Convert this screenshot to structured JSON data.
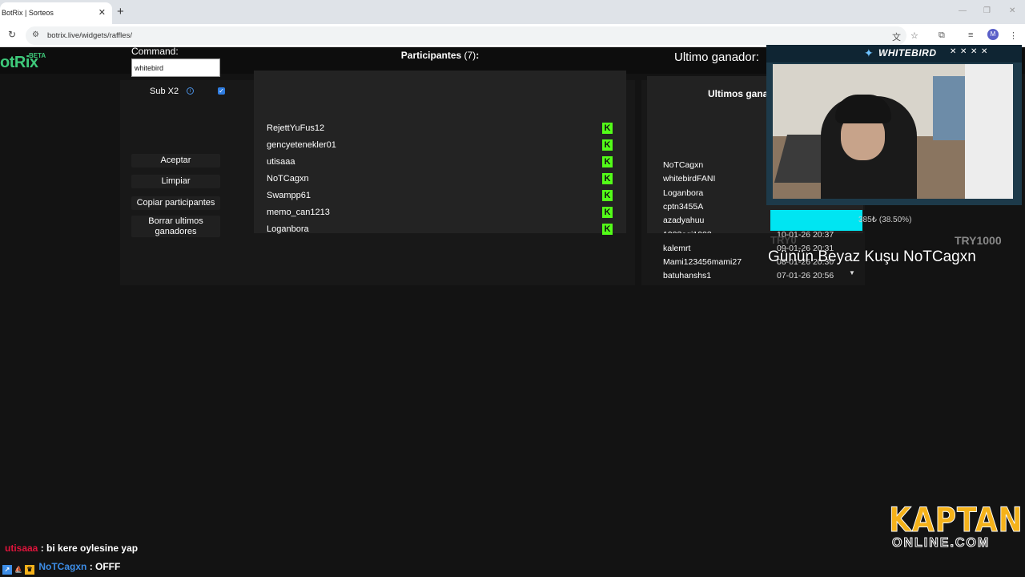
{
  "browser": {
    "tab_title": "BotRix | Sorteos",
    "tab_close": "✕",
    "new_tab": "+",
    "url": "botrix.live/widgets/raffles/",
    "profile_initial": "M"
  },
  "site": {
    "logo": "otRix",
    "beta": "BETA"
  },
  "controls": {
    "command_label": "Command:",
    "command_value": "whitebird",
    "sub_label": "Sub X2",
    "sub_checked": true,
    "accept": "Aceptar",
    "clear": "Limpiar",
    "copy": "Copiar participantes",
    "delete": "Borrar ultimos ganadores"
  },
  "participants": {
    "title": "Participantes",
    "count": "(7)",
    "colon": ":",
    "items": [
      "RejettYuFus12",
      "gencyetenekler01",
      "utisaaa",
      "NoTCagxn",
      "Swampp61",
      "memo_can1213",
      "Loganbora"
    ],
    "kick_glyph": "K"
  },
  "winners": {
    "last_winner_label": "Ultimo ganador:",
    "title": "Ultimos gana",
    "names": [
      "NoTCagxn",
      "whitebirdFANI",
      "Loganbora",
      "cptn3455A",
      "azadyahuu",
      "1903ogi1903",
      "kalemrt",
      "Mami123456mami27",
      "batuhanshs1"
    ],
    "dates": [
      "",
      "",
      "",
      "",
      "",
      "10-01-26 20:37",
      "09-01-26 20:31",
      "08-01-26 20:30",
      "07-01-26 20:56"
    ]
  },
  "overlay": {
    "cam_name": "WHITEBIRD",
    "donation_text": "385₺ (38.50%)",
    "progress_percent": 38.5,
    "try_min": "TRY0",
    "try_max": "TRY1000",
    "gunun": "Günün Beyaz Kuşu NoTCagxn"
  },
  "chat": [
    {
      "user": "utisaaa",
      "message": ": bi kere oylesine yap"
    },
    {
      "user": "NoTCagxn",
      "message": ": OFFF"
    }
  ],
  "kaptan": {
    "main": "KAPTAN",
    "sub": "ONLINE.COM"
  }
}
